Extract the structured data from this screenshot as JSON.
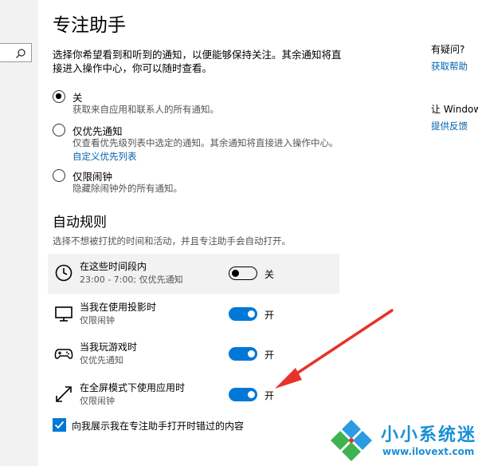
{
  "page": {
    "title": "专注助手",
    "intro": "选择你希望看到和听到的通知，以便能够保持关注。其余通知将直接进入操作中心，你可以随时查看。"
  },
  "options": [
    {
      "label": "关",
      "description": "获取来自应用和联系人的所有通知。",
      "checked": true
    },
    {
      "label": "仅优先通知",
      "description": "仅查看优先级列表中选定的通知。其余通知将直接进入操作中心。",
      "link": "自定义优先列表",
      "checked": false
    },
    {
      "label": "仅限闹钟",
      "description": "隐藏除闹钟外的所有通知。",
      "checked": false
    }
  ],
  "auto_rules": {
    "title": "自动规则",
    "description": "选择不想被打扰的时间和活动，并且专注助手会自动打开。",
    "rules": [
      {
        "name": "在这些时间段内",
        "detail": "23:00 - 7:00; 仅优先通知",
        "state": "关",
        "on": false,
        "icon": "clock-icon"
      },
      {
        "name": "当我在使用投影时",
        "detail": "仅限闹钟",
        "state": "开",
        "on": true,
        "icon": "monitor-icon"
      },
      {
        "name": "当我玩游戏时",
        "detail": "仅优先通知",
        "state": "开",
        "on": true,
        "icon": "gamepad-icon"
      },
      {
        "name": "在全屏模式下使用应用时",
        "detail": "仅限闹钟",
        "state": "开",
        "on": true,
        "icon": "fullscreen-icon"
      }
    ],
    "summary_checkbox": {
      "label": "向我展示我在专注助手打开时错过的内容",
      "checked": true
    }
  },
  "sidebar": {
    "question_heading": "有疑问?",
    "help_link": "获取帮助",
    "improve_heading": "让 Windows",
    "feedback_link": "提供反馈"
  },
  "watermark": {
    "name": "小小系统迷",
    "url": "www.ilovext.com"
  },
  "colors": {
    "accent": "#0078d7",
    "link": "#0063b1",
    "arrow": "#e8322a"
  }
}
